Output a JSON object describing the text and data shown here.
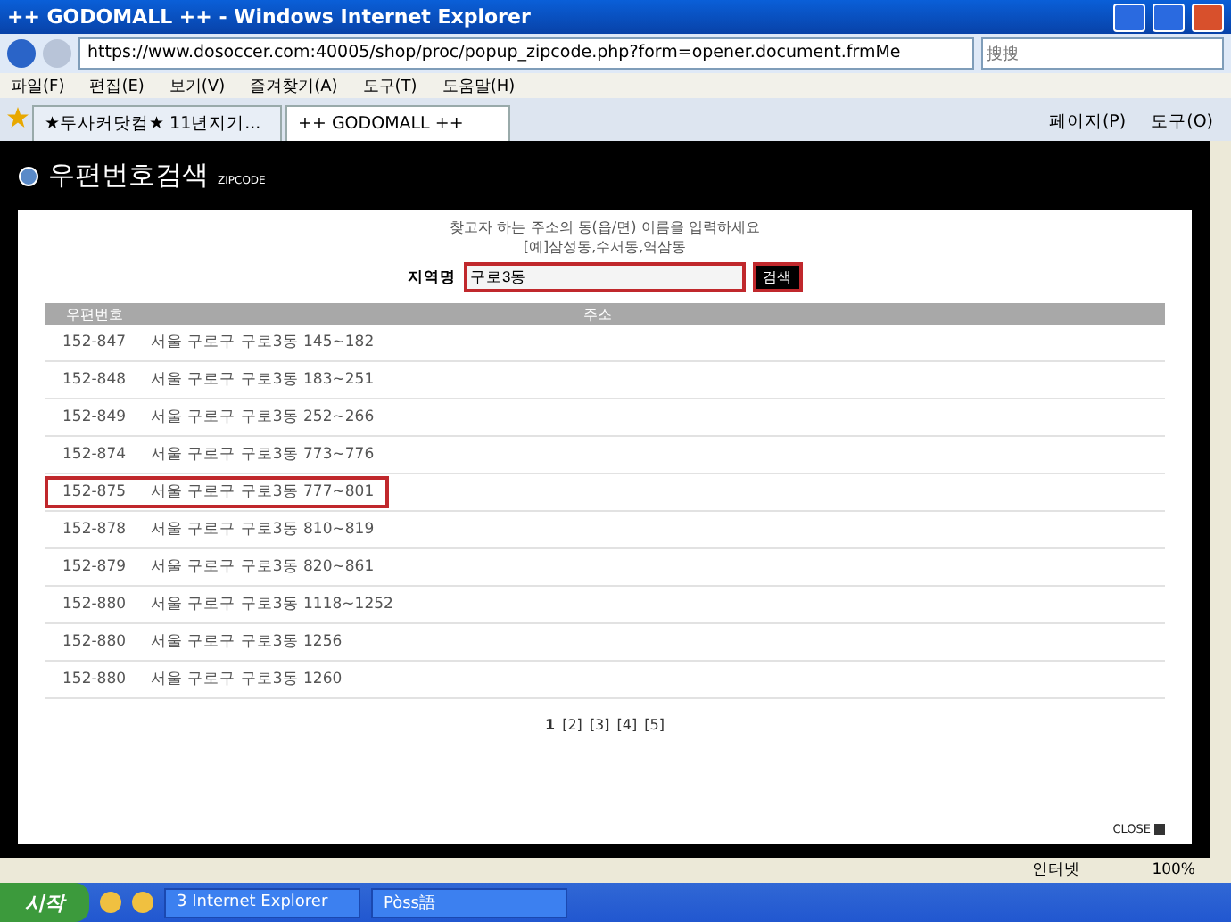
{
  "window": {
    "title": "++ GODOMALL ++ - Windows Internet Explorer"
  },
  "address_bar": {
    "url": "https://www.dosoccer.com:40005/shop/proc/popup_zipcode.php?form=opener.document.frmMe",
    "search_placeholder": "搜搜"
  },
  "menu": [
    "파일(F)",
    "편집(E)",
    "보기(V)",
    "즐겨찾기(A)",
    "도구(T)",
    "도움말(H)"
  ],
  "tabs": [
    {
      "label": "★두사커닷컴★ 11년지기...",
      "selected": false
    },
    {
      "label": "++ GODOMALL ++",
      "selected": true
    }
  ],
  "command_bar": [
    "페이지(P)",
    "도구(O)"
  ],
  "page": {
    "title": "우편번호검색",
    "subtitle": "ZIPCODE",
    "instruction": "찾고자 하는 주소의 동(읍/면) 이름을 입력하세요",
    "example": "[예]삼성동,수서동,역삼동",
    "field_label": "지역명",
    "field_value": "구로3동",
    "field_highlighted": true,
    "search_button": "검색",
    "button_highlighted": true,
    "columns": [
      "우편번호",
      "주소"
    ],
    "rows": [
      {
        "zip": "152-847",
        "address": "서울 구로구 구로3동 145~182",
        "highlighted": false
      },
      {
        "zip": "152-848",
        "address": "서울 구로구 구로3동 183~251",
        "highlighted": false
      },
      {
        "zip": "152-849",
        "address": "서울 구로구 구로3동 252~266",
        "highlighted": false
      },
      {
        "zip": "152-874",
        "address": "서울 구로구 구로3동 773~776",
        "highlighted": false
      },
      {
        "zip": "152-875",
        "address": "서울 구로구 구로3동 777~801",
        "highlighted": true
      },
      {
        "zip": "152-878",
        "address": "서울 구로구 구로3동 810~819",
        "highlighted": false
      },
      {
        "zip": "152-879",
        "address": "서울 구로구 구로3동 820~861",
        "highlighted": false
      },
      {
        "zip": "152-880",
        "address": "서울 구로구 구로3동 1118~1252",
        "highlighted": false
      },
      {
        "zip": "152-880",
        "address": "서울 구로구 구로3동 1256",
        "highlighted": false
      },
      {
        "zip": "152-880",
        "address": "서울 구로구 구로3동 1260",
        "highlighted": false
      }
    ],
    "pages": [
      {
        "label": "1",
        "selected": true
      },
      {
        "label": "[2]",
        "selected": false
      },
      {
        "label": "[3]",
        "selected": false
      },
      {
        "label": "[4]",
        "selected": false
      },
      {
        "label": "[5]",
        "selected": false
      }
    ],
    "close": "CLOSE"
  },
  "status_bar": {
    "zone": "인터넷",
    "zoom": "100%"
  },
  "taskbar": {
    "start": "시작",
    "items": [
      "3 Internet Explorer",
      "Pòss語"
    ]
  }
}
